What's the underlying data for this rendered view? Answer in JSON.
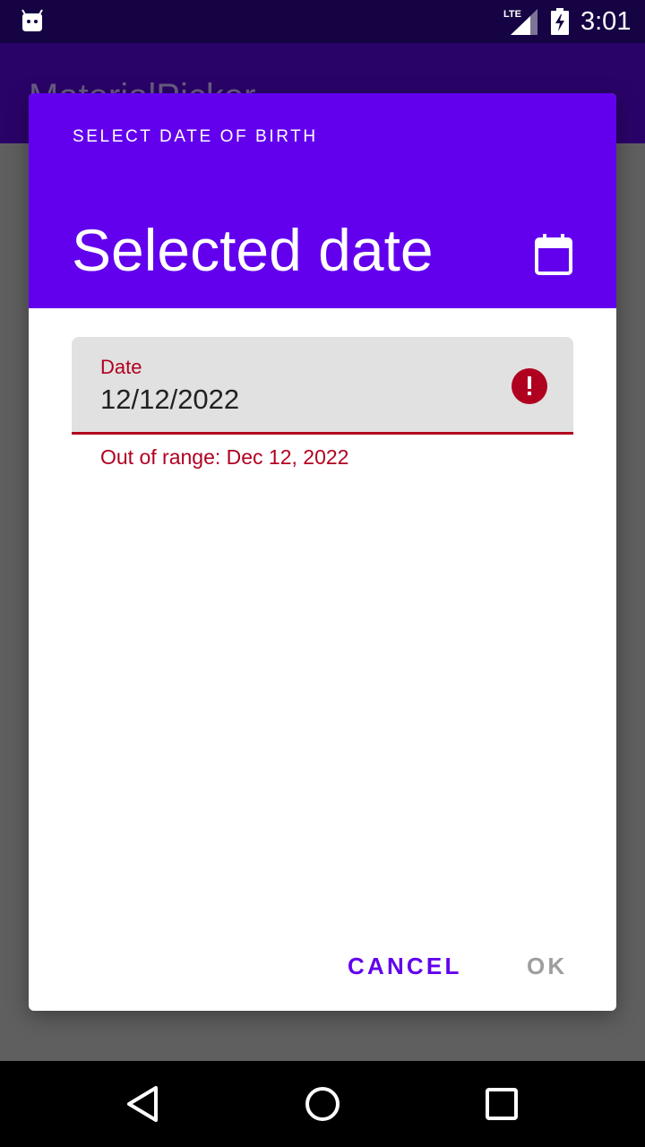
{
  "status_bar": {
    "time": "3:01",
    "network_label": "LTE",
    "icons": [
      "android-notification-icon",
      "lte-signal-icon",
      "battery-charging-icon"
    ]
  },
  "app": {
    "title": "MaterialPicker"
  },
  "dialog": {
    "header_title": "SELECT DATE OF BIRTH",
    "selected_date": "Selected date",
    "calendar_toggle_icon": "calendar-icon",
    "date_field": {
      "label": "Date",
      "value": "12/12/2022",
      "error_icon": "error-icon",
      "error_text": "Out of range: Dec 12, 2022"
    },
    "actions": {
      "cancel_label": "CANCEL",
      "ok_label": "OK"
    }
  },
  "nav_bar": {
    "icons": [
      "back-icon",
      "home-icon",
      "recent-apps-icon"
    ]
  },
  "colors": {
    "primary": "#6200ee",
    "error": "#b00020",
    "status_bar": "#150344",
    "disabled_text": "#9e9e9e"
  }
}
